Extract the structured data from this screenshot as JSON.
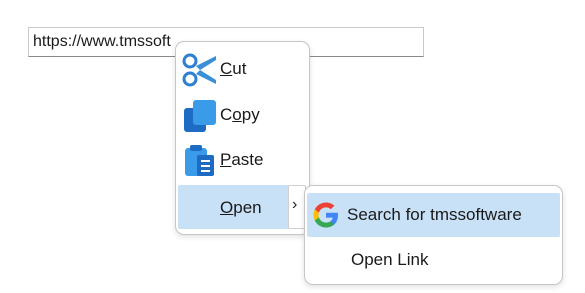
{
  "url_field": {
    "value": "https://www.tmssoft"
  },
  "context_menu": {
    "items": [
      {
        "label_pre": "",
        "label_ul": "C",
        "label_post": "ut",
        "icon": "scissors-icon"
      },
      {
        "label_pre": "C",
        "label_ul": "o",
        "label_post": "py",
        "icon": "copy-icon"
      },
      {
        "label_pre": "",
        "label_ul": "P",
        "label_post": "aste",
        "icon": "clipboard-icon"
      },
      {
        "label_pre": "",
        "label_ul": "O",
        "label_post": "pen",
        "icon": ""
      }
    ],
    "submenu_arrow": "›"
  },
  "submenu": {
    "items": [
      {
        "label": "Search for tmssoftware",
        "icon": "google-icon"
      },
      {
        "label": "Open Link"
      }
    ]
  },
  "colors": {
    "highlight": "#c9e1f7",
    "icon_blue": "#2f8ce0"
  }
}
